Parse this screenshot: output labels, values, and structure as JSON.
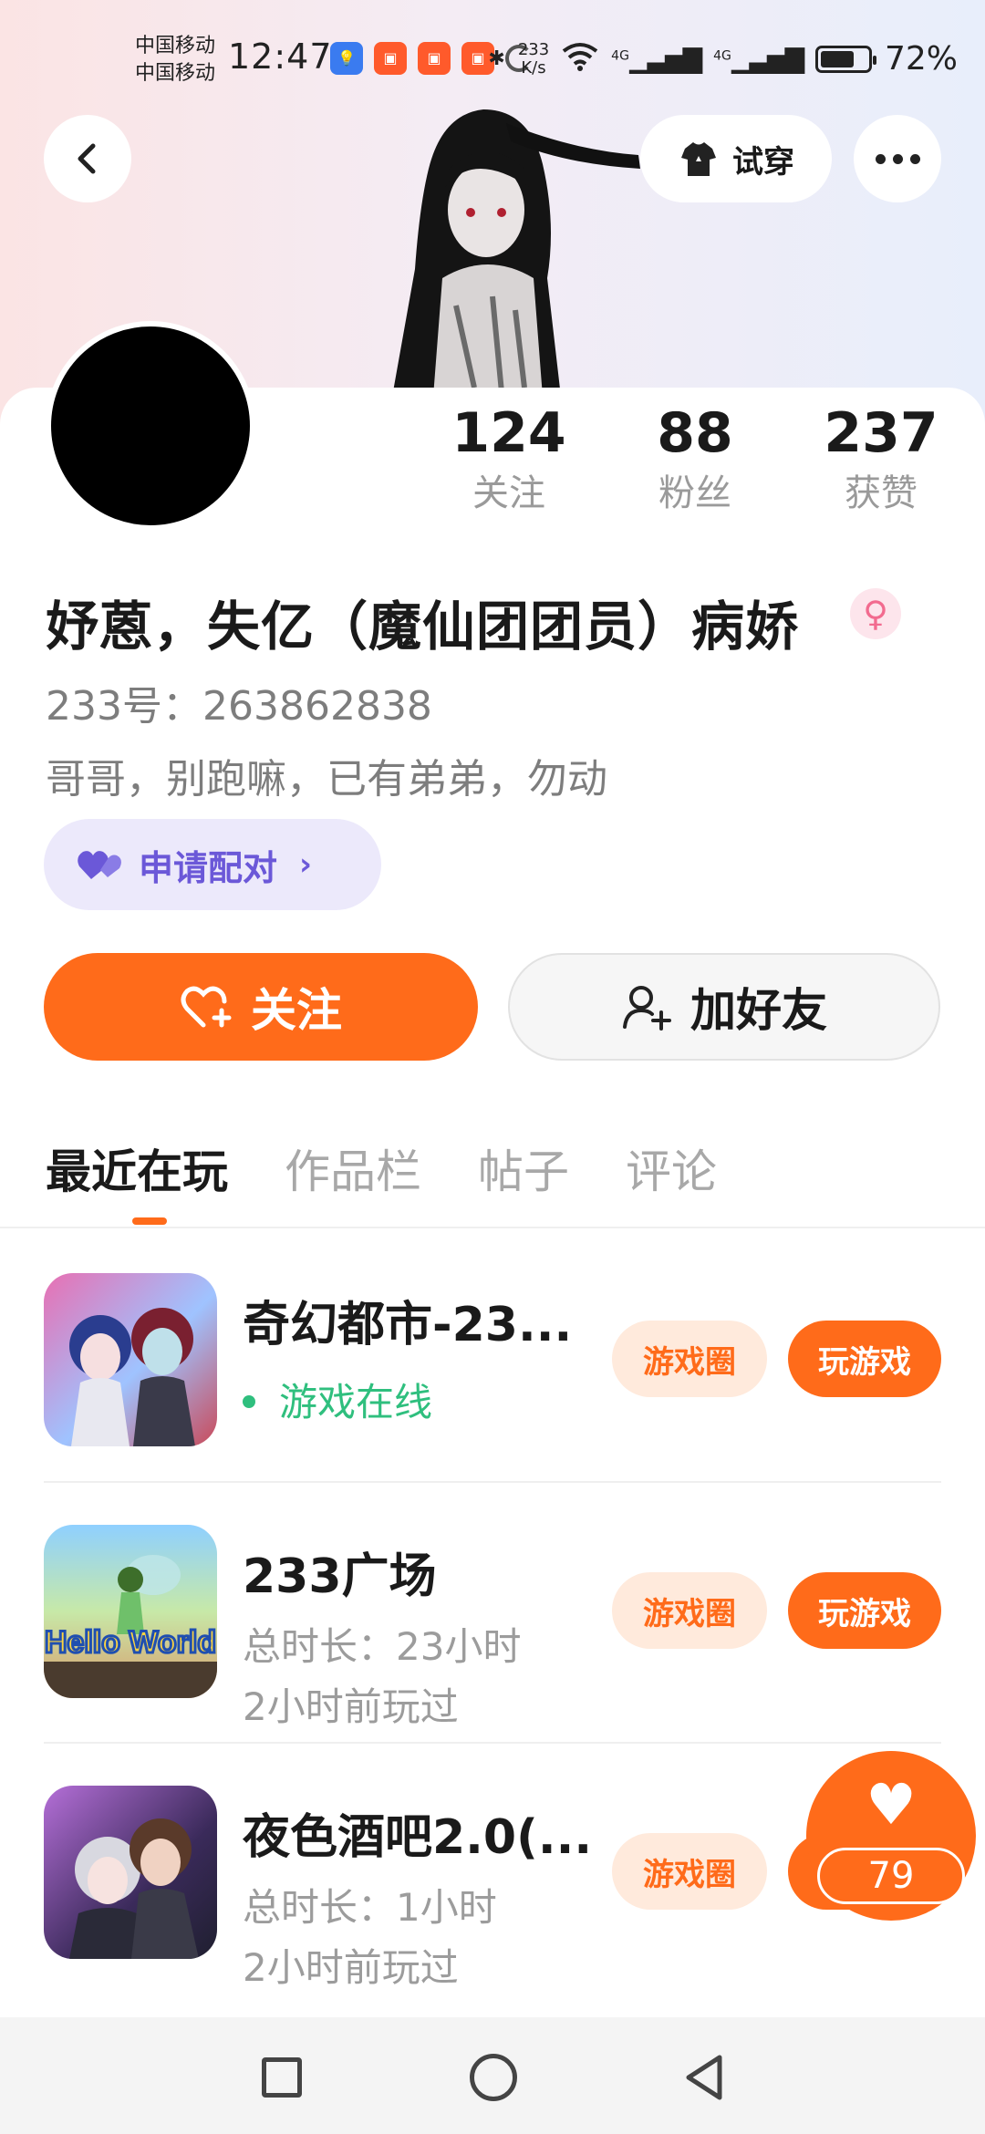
{
  "status_bar": {
    "carrier_1": "中国移动",
    "carrier_2": "中国移动",
    "time": "12:47",
    "speed_top": "233",
    "speed_bottom": "K/s",
    "net_1": "4G",
    "net_2": "4G",
    "battery": "72%",
    "battery_level": 0.72
  },
  "header": {
    "try_on_label": "试穿"
  },
  "profile": {
    "stats": [
      {
        "value": "124",
        "label": "关注"
      },
      {
        "value": "88",
        "label": "粉丝"
      },
      {
        "value": "237",
        "label": "获赞"
      }
    ],
    "username": "妤蒽，失亿（魔仙团团员）病娇",
    "gender_icon": "♀",
    "user_id": "233号：263862838",
    "bio": "哥哥，别跑嘛，已有弟弟，勿动",
    "pair_label": "申请配对"
  },
  "actions": {
    "follow_label": "关注",
    "add_friend_label": "加好友"
  },
  "tabs": [
    {
      "label": "最近在玩",
      "active": true
    },
    {
      "label": "作品栏",
      "active": false
    },
    {
      "label": "帖子",
      "active": false
    },
    {
      "label": "评论",
      "active": false
    }
  ],
  "games": [
    {
      "title": "奇幻都市-23...",
      "status": "游戏在线",
      "circle_label": "游戏圈",
      "play_label": "玩游戏"
    },
    {
      "title": "233广场",
      "duration": "总时长：23小时",
      "last_played": "2小时前玩过",
      "circle_label": "游戏圈",
      "play_label": "玩游戏",
      "thumb_text": "Hello World"
    },
    {
      "title": "夜色酒吧2.0(...",
      "duration": "总时长：1小时",
      "last_played": "2小时前玩过",
      "circle_label": "游戏圈",
      "play_label": "玩游戏"
    }
  ],
  "like_float": {
    "count": "79"
  },
  "colors": {
    "accent": "#ff6b1a",
    "pair_bg": "#ece9fb",
    "pair_text": "#6b58d8",
    "online": "#2fbf7e"
  }
}
